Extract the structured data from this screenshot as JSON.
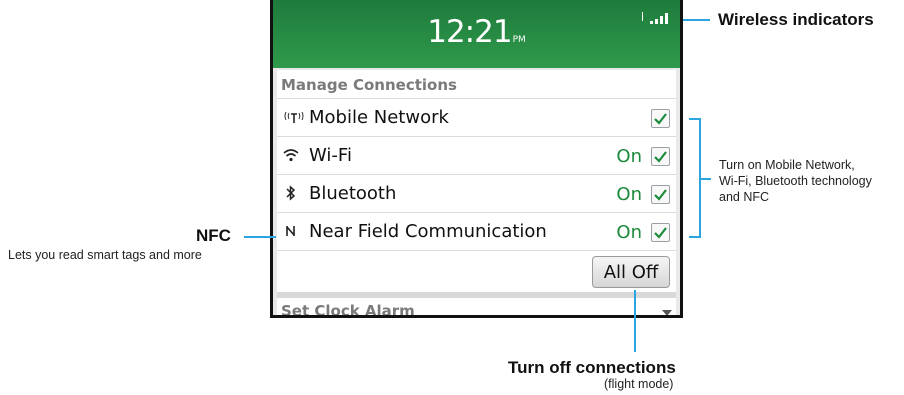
{
  "device": {
    "clock": {
      "time": "12:21",
      "ampm": "PM"
    },
    "section_title": "Manage Connections",
    "connections": [
      {
        "icon": "mobile-network-icon",
        "label": "Mobile Network",
        "status": "",
        "checked": true
      },
      {
        "icon": "wifi-icon",
        "label": "Wi-Fi",
        "status": "On",
        "checked": true
      },
      {
        "icon": "bluetooth-icon",
        "label": "Bluetooth",
        "status": "On",
        "checked": true
      },
      {
        "icon": "nfc-icon",
        "label": "Near Field Communication",
        "status": "On",
        "checked": true
      }
    ],
    "all_off_button": "All Off",
    "next_section_title": "Set Clock Alarm"
  },
  "annotations": {
    "wireless": "Wireless indicators",
    "turn_on": [
      "Turn on Mobile Network,",
      "Wi-Fi, Bluetooth technology",
      "and NFC"
    ],
    "nfc_title": "NFC",
    "nfc_desc": "Lets you read smart tags and more",
    "turn_off_title": "Turn off connections",
    "turn_off_desc": "(flight mode)"
  },
  "colors": {
    "header_green": "#2f9a4b",
    "callout_blue": "#2aa5e0",
    "status_green": "#1b8a3a"
  }
}
